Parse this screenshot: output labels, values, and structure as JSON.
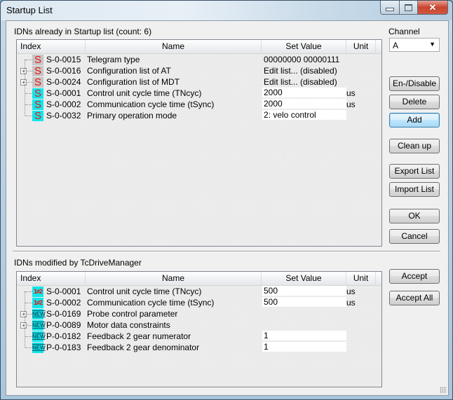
{
  "window": {
    "title": "Startup List",
    "controls": {
      "minimize": "minimize",
      "maximize": "maximize",
      "close": "close"
    }
  },
  "startup": {
    "label": "IDNs already in Startup list (count: 6)",
    "columns": {
      "index": "Index",
      "name": "Name",
      "value": "Set Value",
      "unit": "Unit"
    },
    "rows": [
      {
        "icon": "s-grey",
        "glyph": "S",
        "expandable": false,
        "index": "S-0-0015",
        "name": "Telegram type",
        "value": "00000000 00000111",
        "editable": false,
        "unit": ""
      },
      {
        "icon": "s-grey",
        "glyph": "S",
        "expandable": true,
        "index": "S-0-0016",
        "name": "Configuration list of AT",
        "value": "Edit list... (disabled)",
        "editable": false,
        "unit": ""
      },
      {
        "icon": "s-grey",
        "glyph": "S",
        "expandable": true,
        "index": "S-0-0024",
        "name": "Configuration list of MDT",
        "value": "Edit list... (disabled)",
        "editable": false,
        "unit": ""
      },
      {
        "icon": "s-cyan",
        "glyph": "S",
        "expandable": false,
        "index": "S-0-0001",
        "name": "Control unit cycle time (TNcyc)",
        "value": "2000",
        "editable": true,
        "unit": "us"
      },
      {
        "icon": "s-cyan",
        "glyph": "S",
        "expandable": false,
        "index": "S-0-0002",
        "name": "Communication cycle time (tSync)",
        "value": "2000",
        "editable": true,
        "unit": "us"
      },
      {
        "icon": "s-cyan",
        "glyph": "S",
        "expandable": false,
        "index": "S-0-0032",
        "name": "Primary operation mode",
        "value": "2: velo control",
        "editable": true,
        "unit": ""
      }
    ]
  },
  "channel": {
    "label": "Channel",
    "selected": "A",
    "arrow": "▼"
  },
  "buttons": {
    "endisable": "En-/Disable",
    "delete": "Delete",
    "add": "Add",
    "cleanup": "Clean up",
    "export": "Export List",
    "import": "Import List",
    "ok": "OK",
    "cancel": "Cancel",
    "accept": "Accept",
    "accept_all": "Accept All"
  },
  "modified": {
    "label": "IDNs modified by TcDriveManager",
    "columns": {
      "index": "Index",
      "name": "Name",
      "value": "Set Value",
      "unit": "Unit"
    },
    "rows": [
      {
        "icon": "diff",
        "glyph": "1≠2",
        "expandable": false,
        "index": "S-0-0001",
        "name": "Control unit cycle time (TNcyc)",
        "value": "500",
        "editable": true,
        "unit": "us"
      },
      {
        "icon": "diff",
        "glyph": "1≠2",
        "expandable": false,
        "index": "S-0-0002",
        "name": "Communication cycle time (tSync)",
        "value": "500",
        "editable": true,
        "unit": "us"
      },
      {
        "icon": "new",
        "glyph": "NEW",
        "expandable": true,
        "index": "S-0-0169",
        "name": "Probe control parameter",
        "value": "",
        "editable": false,
        "unit": ""
      },
      {
        "icon": "new",
        "glyph": "NEW",
        "expandable": true,
        "index": "P-0-0089",
        "name": "Motor data constraints",
        "value": "",
        "editable": false,
        "unit": ""
      },
      {
        "icon": "new",
        "glyph": "NEW",
        "expandable": false,
        "index": "P-0-0182",
        "name": "Feedback 2 gear numerator",
        "value": "1",
        "editable": true,
        "unit": ""
      },
      {
        "icon": "new",
        "glyph": "NEW",
        "expandable": false,
        "index": "P-0-0183",
        "name": "Feedback 2 gear denominator",
        "value": "1",
        "editable": true,
        "unit": ""
      }
    ]
  },
  "colors": {
    "accent": "#3c7fb1",
    "cyan_icon": "#12e6ea",
    "red_glyph": "#ee1111",
    "grey_icon": "#c6c6c6"
  }
}
